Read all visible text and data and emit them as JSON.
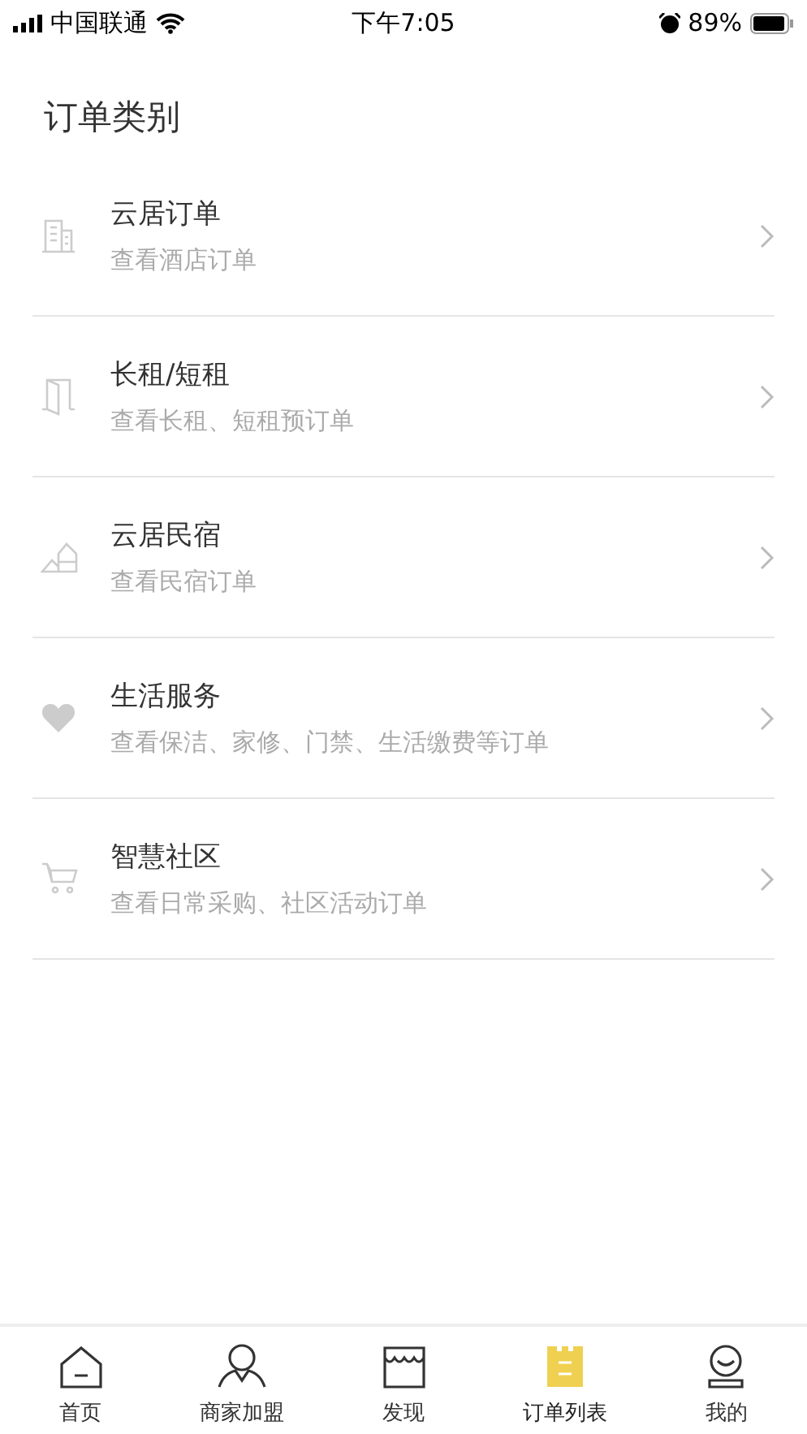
{
  "status_bar": {
    "carrier": "中国联通",
    "time": "下午7:05",
    "battery": "89%"
  },
  "title": "订单类别",
  "categories": [
    {
      "kind": "building",
      "name": "云居订单",
      "description": "查看酒店订单"
    },
    {
      "kind": "door",
      "name": "长租/短租",
      "description": "查看长租、短租预订单"
    },
    {
      "kind": "house",
      "name": "云居民宿",
      "description": "查看民宿订单"
    },
    {
      "kind": "heart",
      "name": "生活服务",
      "description": "查看保洁、家修、门禁、生活缴费等订单"
    },
    {
      "kind": "cart",
      "name": "智慧社区",
      "description": "查看日常采购、社区活动订单"
    }
  ],
  "tabs": [
    {
      "kind": "home",
      "label": "首页",
      "selected": false
    },
    {
      "kind": "person",
      "label": "商家加盟",
      "selected": false
    },
    {
      "kind": "shop",
      "label": "发现",
      "selected": false
    },
    {
      "kind": "list",
      "label": "订单列表",
      "selected": true
    },
    {
      "kind": "profile",
      "label": "我的",
      "selected": false
    }
  ]
}
